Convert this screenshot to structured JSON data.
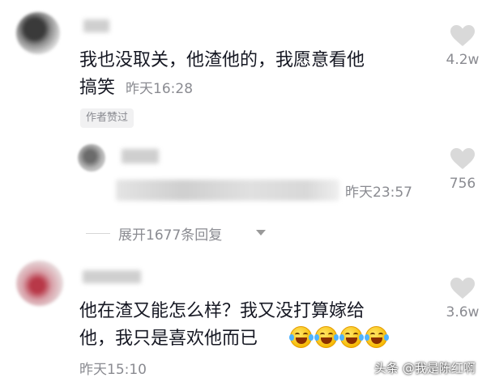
{
  "comment1": {
    "text_line1": "我也没取关，他渣他的，我愿意看他",
    "text_line2": "搞笑",
    "time": "昨天16:28",
    "badge": "作者赞过",
    "likes": "4.2w"
  },
  "reply1": {
    "time": "昨天23:57",
    "likes": "756"
  },
  "expand": {
    "label": "展开1677条回复"
  },
  "comment2": {
    "text_line1": "他在渣又能怎么样？我又没打算嫁给",
    "text_line2": "他，我只是喜欢他而已",
    "time": "昨天15:10",
    "likes": "3.6w",
    "emoji_count": 4
  },
  "watermark": "头条 @我是陈红啊",
  "icons": {
    "like": "heart-icon",
    "expand": "chevron-down-icon",
    "emoji": "rolling-laughing-emoji-icon"
  },
  "colors": {
    "primary_text": "#161823",
    "secondary_text": "#8a8b91",
    "heart": "#d9d9d9"
  }
}
